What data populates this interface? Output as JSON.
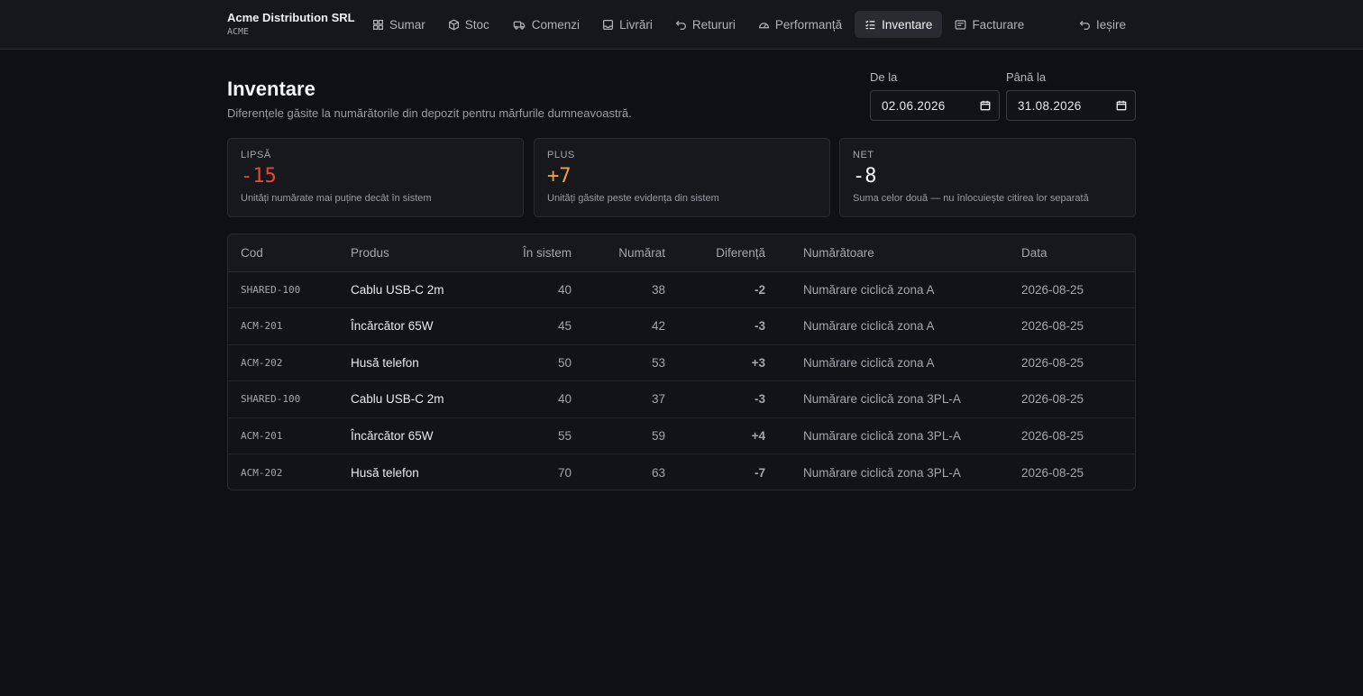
{
  "brand": {
    "name": "Acme Distribution SRL",
    "code": "ACME"
  },
  "nav": {
    "items": [
      {
        "label": "Sumar",
        "icon": "grid-icon"
      },
      {
        "label": "Stoc",
        "icon": "box-icon"
      },
      {
        "label": "Comenzi",
        "icon": "truck-icon"
      },
      {
        "label": "Livrări",
        "icon": "inbox-icon"
      },
      {
        "label": "Retururi",
        "icon": "undo-icon"
      },
      {
        "label": "Performanță",
        "icon": "gauge-icon"
      },
      {
        "label": "Inventare",
        "icon": "checklist-icon",
        "active": true
      },
      {
        "label": "Facturare",
        "icon": "receipt-icon"
      }
    ],
    "logout": "Ieșire"
  },
  "header": {
    "title": "Inventare",
    "subtitle": "Diferențele găsite la numărătorile din depozit pentru mărfurile dumneavoastră."
  },
  "filters": {
    "from_label": "De la",
    "from_value": "02.06.2026",
    "to_label": "Până la",
    "to_value": "31.08.2026"
  },
  "cards": {
    "lipsa": {
      "label": "LIPSĂ",
      "value": "-15",
      "desc": "Unități numărate mai puține decât în sistem",
      "color": "#e5473c"
    },
    "plus": {
      "label": "PLUS",
      "value": "+7",
      "desc": "Unități găsite peste evidența din sistem",
      "color": "#f0a03a"
    },
    "net": {
      "label": "NET",
      "value": "-8",
      "desc": "Suma celor două — nu înlocuiește citirea lor separată",
      "color": "#f5f5f7"
    }
  },
  "table": {
    "headers": {
      "cod": "Cod",
      "produs": "Produs",
      "sistem": "În sistem",
      "numarat": "Numărat",
      "diferenta": "Diferență",
      "numaratoare": "Numărătoare",
      "data": "Data"
    },
    "rows": [
      {
        "cod": "SHARED-100",
        "produs": "Cablu USB-C 2m",
        "sistem": "40",
        "numarat": "38",
        "diferenta": "-2",
        "numaratoare": "Numărare ciclică zona A",
        "data": "2026-08-25"
      },
      {
        "cod": "ACM-201",
        "produs": "Încărcător 65W",
        "sistem": "45",
        "numarat": "42",
        "diferenta": "-3",
        "numaratoare": "Numărare ciclică zona A",
        "data": "2026-08-25"
      },
      {
        "cod": "ACM-202",
        "produs": "Husă telefon",
        "sistem": "50",
        "numarat": "53",
        "diferenta": "+3",
        "numaratoare": "Numărare ciclică zona A",
        "data": "2026-08-25"
      },
      {
        "cod": "SHARED-100",
        "produs": "Cablu USB-C 2m",
        "sistem": "40",
        "numarat": "37",
        "diferenta": "-3",
        "numaratoare": "Numărare ciclică zona 3PL-A",
        "data": "2026-08-25"
      },
      {
        "cod": "ACM-201",
        "produs": "Încărcător 65W",
        "sistem": "55",
        "numarat": "59",
        "diferenta": "+4",
        "numaratoare": "Numărare ciclică zona 3PL-A",
        "data": "2026-08-25"
      },
      {
        "cod": "ACM-202",
        "produs": "Husă telefon",
        "sistem": "70",
        "numarat": "63",
        "diferenta": "-7",
        "numaratoare": "Numărare ciclică zona 3PL-A",
        "data": "2026-08-25"
      }
    ]
  }
}
